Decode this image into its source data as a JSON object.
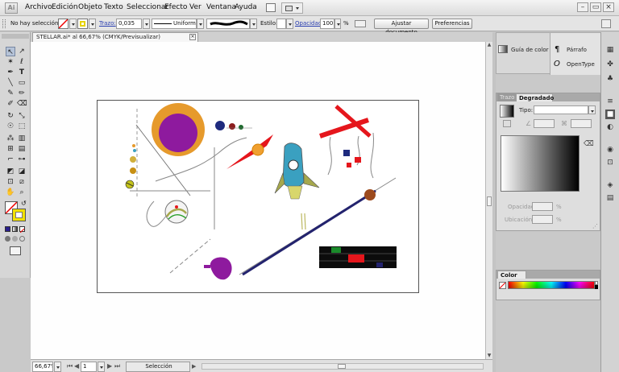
{
  "app": {
    "logo_text": "Ai"
  },
  "menu": [
    "Archivo",
    "Edición",
    "Objeto",
    "Texto",
    "Seleccionar",
    "Efecto",
    "Ver",
    "Ventana",
    "Ayuda"
  ],
  "control_bar": {
    "selection_status": "No hay selección",
    "stroke_label": "Trazo:",
    "stroke_weight": "0,035",
    "stroke_profile": "Uniforme",
    "style_label": "Estilo:",
    "opacity_label": "Opacidad:",
    "opacity_value": "100",
    "percent": "%",
    "adjust_doc_button": "Ajustar documento",
    "preferences_button": "Preferencias"
  },
  "document_tab": {
    "title": "STELLAR.ai* al 66,67% (CMYK/Previsualizar)",
    "close": "×"
  },
  "status_bar": {
    "zoom": "66,67%",
    "page": "1",
    "tool": "Selección"
  },
  "panels": {
    "color_guide_label": "Guía de color",
    "paragraph_label": "Párrafo",
    "opentype_label": "OpenType",
    "stroke_tab": "Trazo",
    "gradient_tab": "Degradado",
    "type_label": "Tipo:",
    "opacity_label": "Opacidad:",
    "location_label": "Ubicación:",
    "percent": "%",
    "color_tab": "Color"
  },
  "colors": {
    "orange_circle": "#e69a2c",
    "purple": "#8e1a9e",
    "red": "#e5161c",
    "navy": "#23236e",
    "teal": "#3aa0c0",
    "olive": "#a6a84c",
    "brown": "#9c4a1e"
  },
  "icons": {
    "tools": [
      "selection-tool-icon",
      "direct-selection-tool-icon",
      "magic-wand-icon",
      "lasso-icon",
      "pen-tool-icon",
      "type-tool-icon",
      "line-tool-icon",
      "rectangle-tool-icon",
      "paintbrush-icon",
      "pencil-icon",
      "blob-brush-icon",
      "eraser-icon",
      "rotate-icon",
      "scale-icon",
      "warp-icon",
      "free-transform-icon",
      "symbol-sprayer-icon",
      "graph-tool-icon",
      "mesh-tool-icon",
      "gradient-tool-icon",
      "eyedropper-icon",
      "blend-tool-icon",
      "live-paint-icon",
      "live-paint-selection-icon",
      "artboard-tool-icon",
      "slice-tool-icon",
      "hand-tool-icon",
      "zoom-tool-icon"
    ]
  }
}
